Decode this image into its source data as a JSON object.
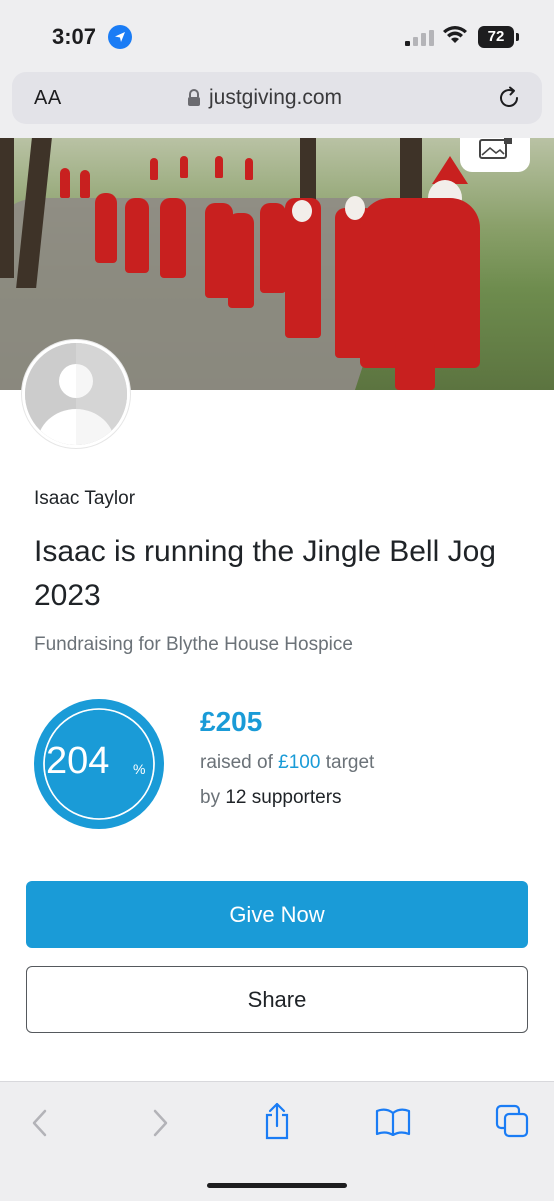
{
  "status_bar": {
    "time": "3:07",
    "battery": "72"
  },
  "browser": {
    "aa_label": "AA",
    "url": "justgiving.com"
  },
  "page": {
    "owner_name": "Isaac Taylor",
    "title": "Isaac is running the Jingle Bell Jog 2023",
    "charity_line": "Fundraising for Blythe House Hospice",
    "progress": {
      "percent_number": "204",
      "percent_sign": "%",
      "fraction": 2.04
    },
    "raised_amount": "£205",
    "raised_of_label": "raised of",
    "target_amount": "£100",
    "target_label": "target",
    "by_label": "by",
    "supporters": "12 supporters",
    "give_button": "Give Now",
    "share_button": "Share"
  },
  "colors": {
    "brand": "#1a9bd7",
    "ios_blue": "#1a7cf5",
    "text": "#1f2327",
    "muted": "#6b7278"
  },
  "icons": [
    "location-arrow-icon",
    "signal-icon",
    "wifi-icon",
    "battery-icon",
    "lock-icon",
    "reload-icon",
    "edit-image-icon",
    "back-icon",
    "forward-icon",
    "share-icon",
    "bookmarks-icon",
    "tabs-icon"
  ]
}
